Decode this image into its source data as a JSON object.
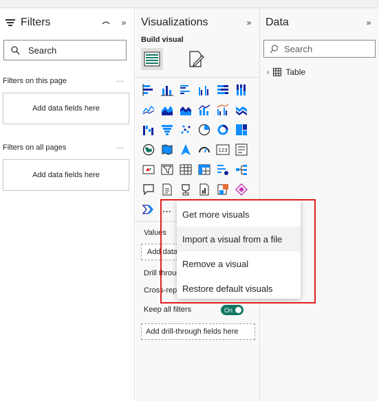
{
  "filters": {
    "title": "Filters",
    "search_placeholder": "Search",
    "on_this_page_label": "Filters on this page",
    "on_all_pages_label": "Filters on all pages",
    "add_fields_text": "Add data fields here",
    "more_label": "..."
  },
  "visualizations": {
    "title": "Visualizations",
    "build_visual_label": "Build visual",
    "values_label": "Values",
    "add_data_fields": "Add data fields here",
    "drill_through_label": "Drill through",
    "cross_report_label": "Cross-report",
    "keep_all_filters_label": "Keep all filters",
    "toggle_label": "On",
    "add_drill_through": "Add drill-through fields here",
    "more_visuals": "..."
  },
  "data": {
    "title": "Data",
    "search_placeholder": "Search",
    "table_label": "Table"
  },
  "context_menu": {
    "items": [
      "Get more visuals",
      "Import a visual from a file",
      "Remove a visual",
      "Restore default visuals"
    ],
    "hovered_index": 1
  },
  "colors": {
    "accent_blue": "#118dff",
    "dark_blue": "#12239e",
    "toggle_green": "#117865",
    "highlight_red": "#e02020"
  }
}
